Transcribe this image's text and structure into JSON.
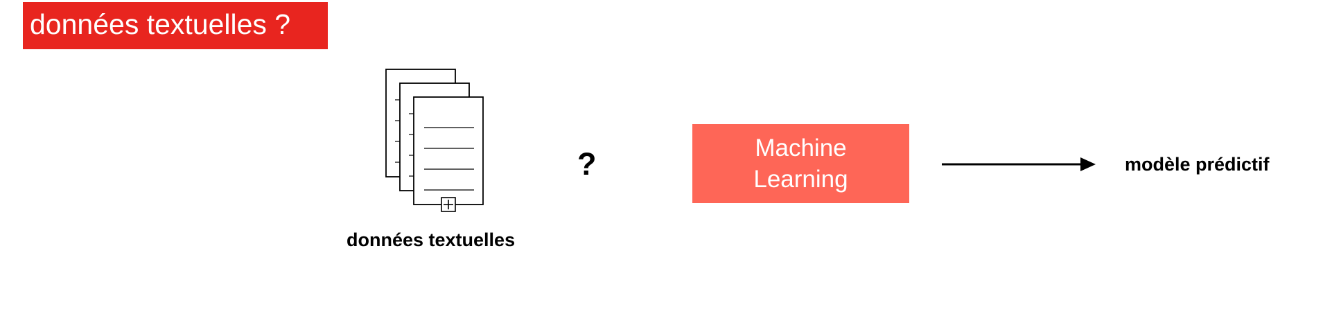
{
  "title": {
    "text": "données textuelles ?",
    "bg_color": "#e8251f",
    "text_color": "#ffffff"
  },
  "diagram": {
    "input_icon": "documents-stack-icon",
    "input_label": "données textuelles",
    "connector_symbol": "?",
    "process": {
      "line1": "Machine",
      "line2": "Learning",
      "bg_color": "#fe6657",
      "text_color": "#ffffff"
    },
    "arrow_icon": "right-arrow-icon",
    "output_label": "modèle prédictif"
  }
}
